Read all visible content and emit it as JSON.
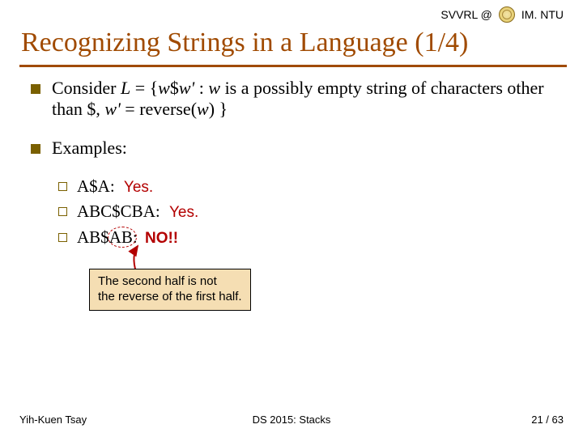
{
  "header": {
    "left": "SVVRL @",
    "right": "IM. NTU"
  },
  "title": "Recognizing Strings in a Language (1/4)",
  "body": {
    "consider_prefix": "Consider ",
    "consider_L": "L",
    "consider_eq": " = {",
    "consider_w": "w",
    "consider_dollar": "$",
    "consider_wprime": "w'",
    "consider_mid": " : ",
    "consider_w2": "w",
    "consider_text1": " is a possibly empty string of characters other than $, ",
    "consider_wprime2": "w'",
    "consider_eq2": " = reverse(",
    "consider_w3": "w",
    "consider_close": ") }",
    "examples_label": "Examples:",
    "ex1_text": "A$A:",
    "ex1_ans": "Yes.",
    "ex2_text": "ABC$CBA:",
    "ex2_ans": "Yes.",
    "ex3_prefix": "AB$",
    "ex3_circled": "AB",
    "ex3_colon": ":",
    "ex3_ans": "NO!!"
  },
  "note": {
    "line1": "The second half is not",
    "line2": "the reverse of the first half."
  },
  "footer": {
    "left": "Yih-Kuen Tsay",
    "center": "DS 2015: Stacks",
    "right": "21 / 63"
  }
}
